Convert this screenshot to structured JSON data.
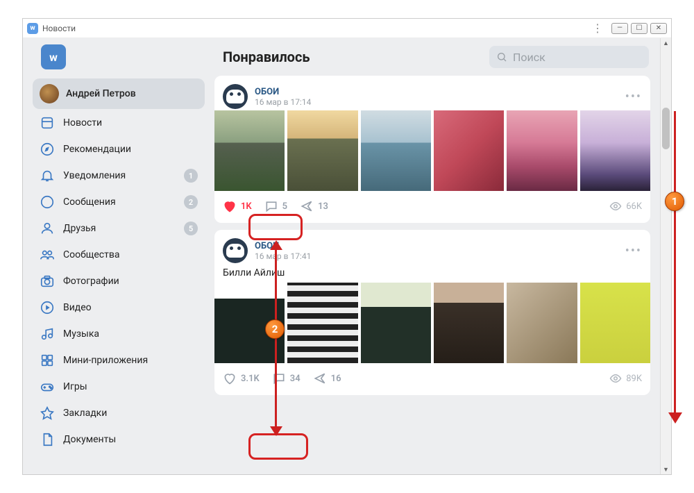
{
  "window": {
    "title": "Новости"
  },
  "header": {
    "page_title": "Понравилось",
    "search_placeholder": "Поиск"
  },
  "profile": {
    "name": "Андрей Петров"
  },
  "nav": {
    "items": [
      {
        "id": "news",
        "label": "Новости",
        "badge": null
      },
      {
        "id": "recommend",
        "label": "Рекомендации",
        "badge": null
      },
      {
        "id": "notifications",
        "label": "Уведомления",
        "badge": "1"
      },
      {
        "id": "messages",
        "label": "Сообщения",
        "badge": "2"
      },
      {
        "id": "friends",
        "label": "Друзья",
        "badge": "5"
      },
      {
        "id": "groups",
        "label": "Сообщества",
        "badge": null
      },
      {
        "id": "photos",
        "label": "Фотографии",
        "badge": null
      },
      {
        "id": "video",
        "label": "Видео",
        "badge": null
      },
      {
        "id": "music",
        "label": "Музыка",
        "badge": null
      },
      {
        "id": "miniapps",
        "label": "Мини-приложения",
        "badge": null
      },
      {
        "id": "games",
        "label": "Игры",
        "badge": null
      },
      {
        "id": "bookmarks",
        "label": "Закладки",
        "badge": null
      },
      {
        "id": "documents",
        "label": "Документы",
        "badge": null
      }
    ]
  },
  "posts": [
    {
      "author": "ОБОИ",
      "date": "16 мар в 17:14",
      "text": "",
      "likes": "1K",
      "liked": true,
      "comments": "5",
      "shares": "13",
      "views": "66K"
    },
    {
      "author": "ОБОИ",
      "date": "16 мар в 17:41",
      "text": "Билли Айлиш",
      "likes": "3.1K",
      "liked": false,
      "comments": "34",
      "shares": "16",
      "views": "89K"
    }
  ],
  "annotations": {
    "marker1": "1",
    "marker2": "2"
  }
}
